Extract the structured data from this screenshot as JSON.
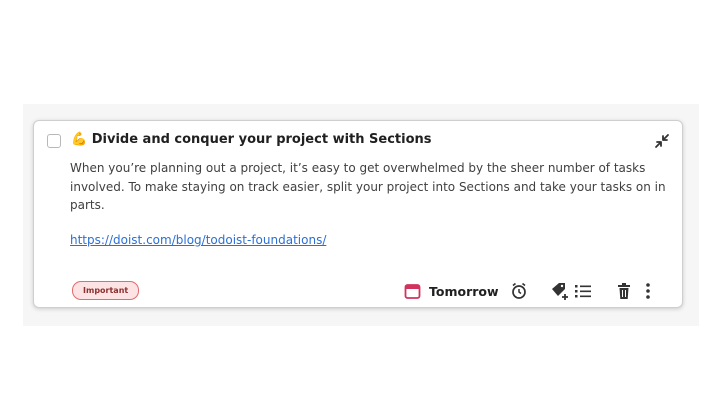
{
  "task": {
    "emoji": "💪",
    "title": "Divide and conquer your project with Sections",
    "description": "When you’re planning out a project, it’s easy to get overwhelmed by the sheer number of tasks involved. To make staying on track easier, split your project into Sections and take your tasks on in parts.",
    "link": "https://doist.com/blog/todoist-foundations/",
    "label": "Important",
    "due_date": "Tomorrow"
  },
  "icons": {
    "collapse": "collapse-arrows-icon",
    "calendar": "calendar-icon",
    "reminder": "alarm-clock-icon",
    "labels": "tag-add-icon",
    "subtasks": "list-icon",
    "delete": "trash-icon",
    "more": "more-vertical-icon"
  },
  "colors": {
    "label_bg": "#fde3e3",
    "label_border": "#e06c6c",
    "calendar": "#d1335e",
    "link": "#2b6fd6"
  }
}
